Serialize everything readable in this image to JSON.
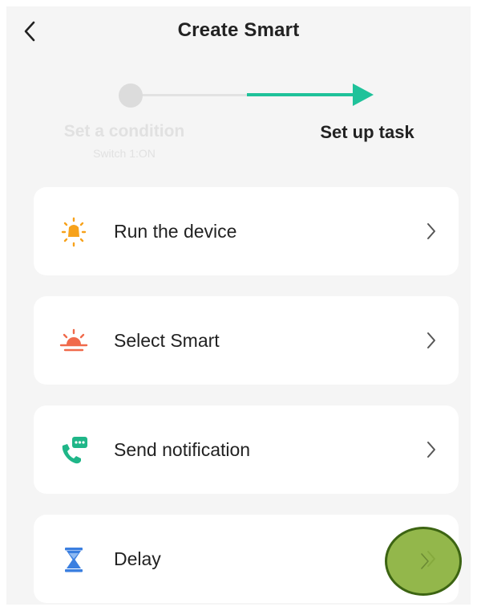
{
  "header": {
    "title": "Create Smart",
    "back_icon": "chevron-left-icon"
  },
  "stepper": {
    "step1_label": "Set a condition",
    "step1_sub": "Switch 1:ON",
    "step2_label": "Set up task",
    "active_step": 2,
    "accent_color": "#1fc29a",
    "inactive_color": "#dcdcdc"
  },
  "tasks": [
    {
      "label": "Run the device",
      "icon": "sun-device-icon",
      "icon_color": "#f7a21b"
    },
    {
      "label": "Select Smart",
      "icon": "sunrise-icon",
      "icon_color": "#f06a4b"
    },
    {
      "label": "Send notification",
      "icon": "phone-message-icon",
      "icon_color": "#1fb688"
    },
    {
      "label": "Delay",
      "icon": "hourglass-icon",
      "icon_color": "#3b7fe0"
    }
  ],
  "highlight": {
    "color": "#8ab13c",
    "target": "Delay"
  }
}
